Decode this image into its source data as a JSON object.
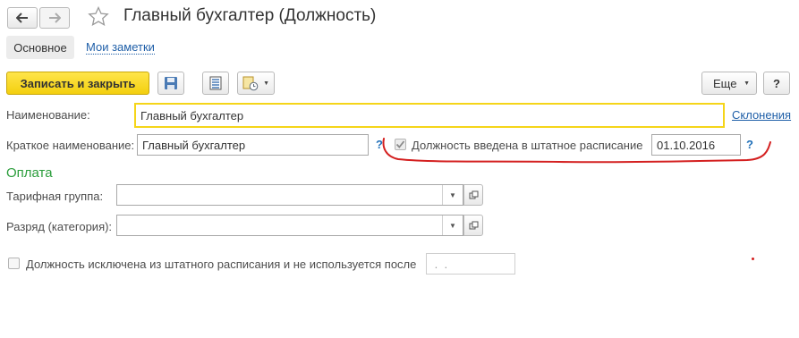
{
  "header": {
    "title": "Главный бухгалтер (Должность)"
  },
  "tabs": {
    "main": "Основное",
    "notes": "Мои заметки"
  },
  "toolbar": {
    "save_close": "Записать и закрыть",
    "more": "Еще",
    "help": "?"
  },
  "form": {
    "name_label": "Наименование:",
    "name_value": "Главный бухгалтер",
    "declension_link": "Склонения",
    "short_name_label": "Краткое наименование:",
    "short_name_value": "Главный бухгалтер",
    "help_mark": "?",
    "staffing_checkbox_label": "Должность введена в штатное расписание",
    "staffing_checked": true,
    "staffing_date": "01.10.2016",
    "payment_section": "Оплата",
    "tariff_group_label": "Тарифная группа:",
    "tariff_group_value": "",
    "grade_label": "Разряд (категория):",
    "grade_value": "",
    "excluded_checkbox_label": "Должность исключена из штатного расписания и не используется после",
    "excluded_checked": false,
    "excluded_date": " .  ."
  },
  "colors": {
    "accent_yellow": "#f5d519",
    "link_blue": "#1f5fa8",
    "section_green": "#2a9d3b",
    "annotation_red": "#d42020"
  }
}
